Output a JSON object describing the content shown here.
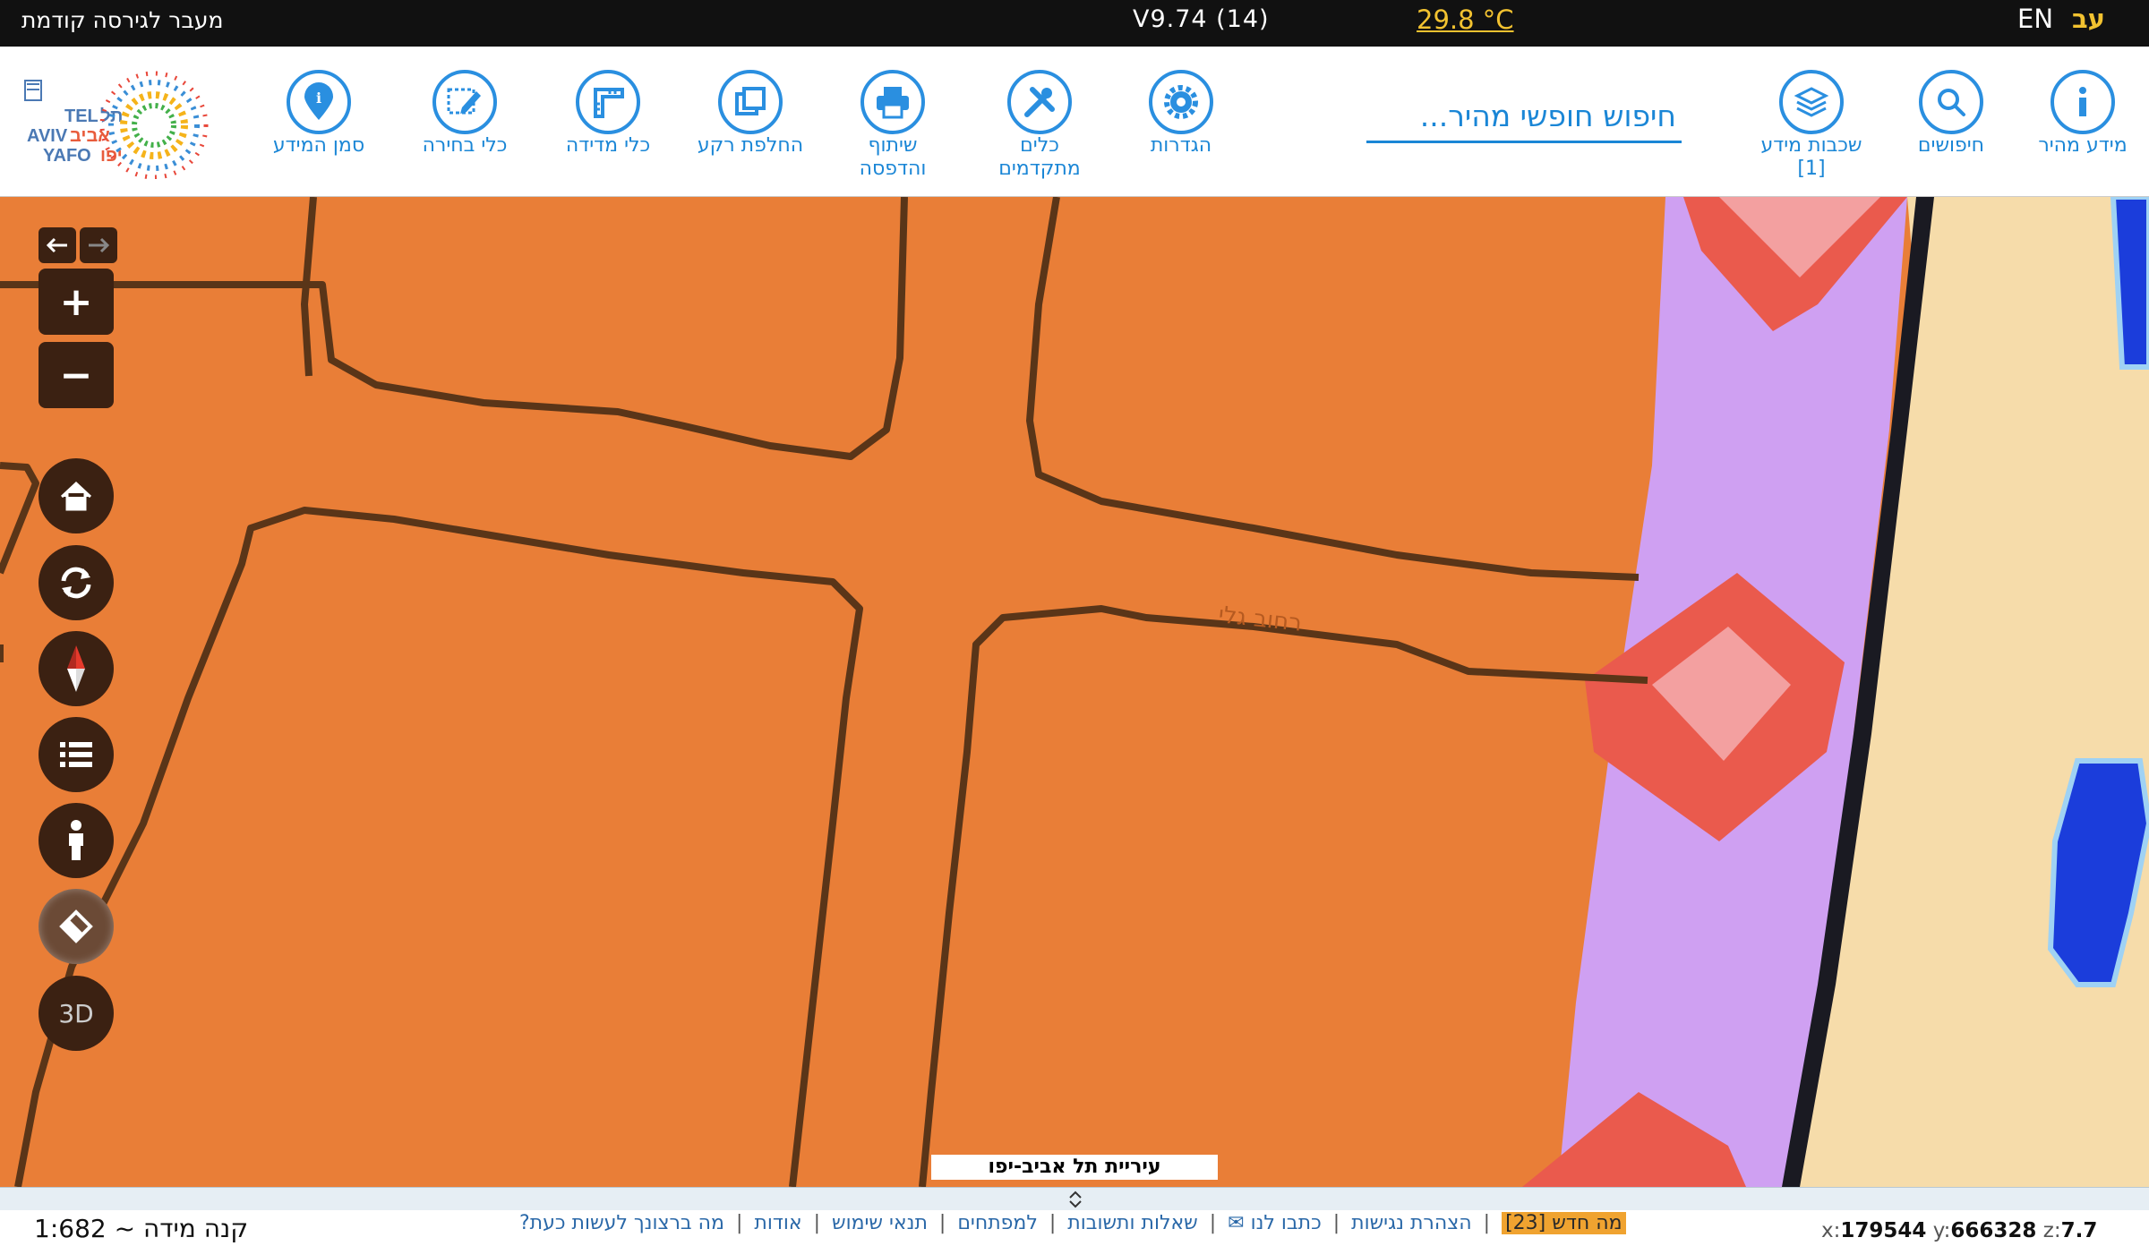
{
  "topbar": {
    "prev_version": "מעבר לגירסה קודמת",
    "version": "V9.74 (14)",
    "temperature": "29.8 °C",
    "lang_en": "EN",
    "lang_he": "עב"
  },
  "logo": {
    "text_lines": [
      "TEL",
      "AVIV",
      "YAFO",
      "תל",
      "אביב",
      "יפו"
    ]
  },
  "toolbar": {
    "tools": [
      {
        "label": "סמן המידע",
        "icon": "map-pin-info-icon"
      },
      {
        "label": "כלי בחירה",
        "icon": "selection-edit-icon"
      },
      {
        "label": "כלי מדידה",
        "icon": "ruler-icon"
      },
      {
        "label": "החלפת רקע",
        "icon": "layers-copy-icon"
      },
      {
        "label": "שיתוף והדפסה",
        "icon": "printer-icon"
      },
      {
        "label": "כלים מתקדמים",
        "icon": "tools-icon"
      },
      {
        "label": "הגדרות",
        "icon": "gear-icon"
      },
      {
        "label": "שכבות מידע [1]",
        "icon": "layers-icon"
      },
      {
        "label": "חיפושים",
        "icon": "search-icon"
      },
      {
        "label": "מידע מהיר",
        "icon": "info-icon"
      }
    ],
    "search_placeholder": "חיפוש חופשי מהיר..."
  },
  "map": {
    "street_label_1": "רחוב גלי",
    "municipality_label": "עיריית תל אביב-יפו",
    "controls": {
      "zoom_in": "+",
      "zoom_out": "−",
      "three_d": "3D"
    },
    "colors": {
      "land": "#e97e37",
      "road_purple": "#cfa0f2",
      "beach": "#f6dcaa",
      "water": "#1b3ddb",
      "accent_red": "#ea5a4d"
    }
  },
  "bottom": {
    "scale": "קנה מידה ~ 1:682",
    "links": [
      "מה ברצונך לעשות כעת?",
      "אודות",
      "תנאי שימוש",
      "למפתחים",
      "שאלות ותשובות",
      "כתבו לנו ✉",
      "הצהרת נגישות"
    ],
    "whats_new": "מה חדש [23]",
    "coord_x_key": "x:",
    "coord_x": "179544",
    "coord_y_key": "y:",
    "coord_y": "666328",
    "coord_z_key": "z:",
    "coord_z": "7.7"
  }
}
